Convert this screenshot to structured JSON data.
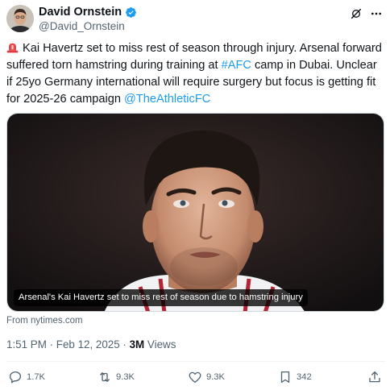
{
  "author": {
    "display_name": "David Ornstein",
    "handle": "@David_Ornstein",
    "verified": true
  },
  "tweet": {
    "segments": [
      {
        "text": "Kai Havertz set to miss rest of season through injury. Arsenal forward suffered torn hamstring during training at ",
        "type": "text"
      },
      {
        "text": "#AFC",
        "type": "hashtag"
      },
      {
        "text": " camp in Dubai. Unclear if 25yo Germany international will require surgery but focus is getting fit for 2025-26 campaign ",
        "type": "text"
      },
      {
        "text": "@TheAthleticFC",
        "type": "mention"
      }
    ],
    "lead_icon": "siren-emoji"
  },
  "media": {
    "caption": "Arsenal's Kai Havertz set to miss rest of season due to hamstring injury",
    "source": "From nytimes.com"
  },
  "meta": {
    "timestamp": "1:51 PM · Feb 12, 2025 · ",
    "views_count": "3M",
    "views_label": " Views"
  },
  "actions": {
    "replies": "1.7K",
    "reposts": "9.3K",
    "likes": "9.3K",
    "bookmarks": "342"
  },
  "colors": {
    "link": "#1d9bf0",
    "secondary_text": "#536471",
    "primary_text": "#0f1419",
    "verified_badge": "#1d9bf0"
  }
}
